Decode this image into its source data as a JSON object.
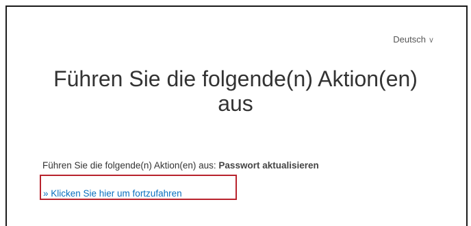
{
  "language_selector": {
    "label": "Deutsch",
    "chevron": "v",
    "icon": "chevron-down-icon"
  },
  "page": {
    "title": "Führen Sie die folgende(n) Aktion(en) aus"
  },
  "instruction": {
    "prefix": "Führen Sie die folgende(n) Aktion(en) aus:",
    "action": "Passwort aktualisieren"
  },
  "continue_link": {
    "label": "» Klicken Sie hier um fortzufahren"
  },
  "colors": {
    "link": "#0a6fbf",
    "highlight_border": "#b8222c",
    "text": "#333333"
  }
}
